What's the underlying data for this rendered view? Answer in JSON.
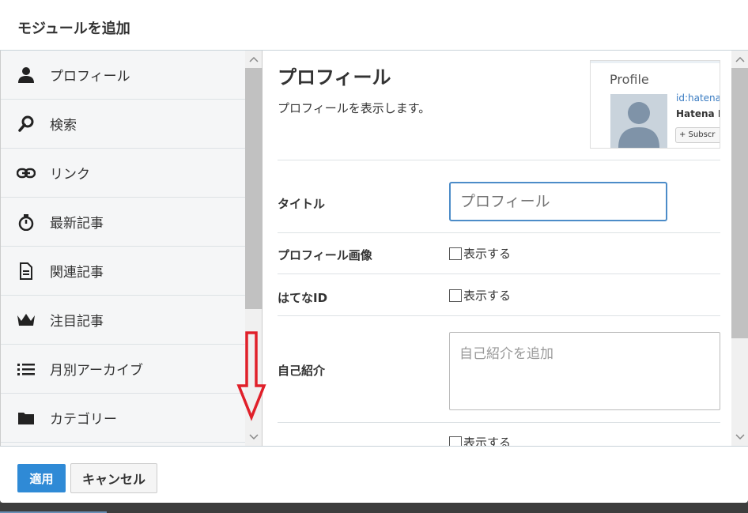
{
  "dialog": {
    "title": "モジュールを追加"
  },
  "sidebar": {
    "items": [
      {
        "label": "プロフィール",
        "icon": "person-icon"
      },
      {
        "label": "検索",
        "icon": "search-icon"
      },
      {
        "label": "リンク",
        "icon": "link-icon"
      },
      {
        "label": "最新記事",
        "icon": "stopwatch-icon"
      },
      {
        "label": "関連記事",
        "icon": "document-icon"
      },
      {
        "label": "注目記事",
        "icon": "crown-icon"
      },
      {
        "label": "月別アーカイブ",
        "icon": "list-icon"
      },
      {
        "label": "カテゴリー",
        "icon": "folder-icon"
      }
    ]
  },
  "module": {
    "title": "プロフィール",
    "description": "プロフィールを表示します。",
    "preview": {
      "heading": "Profile",
      "id_text": "id:hatena",
      "name_text": "Hatena B",
      "subscribe_text": "+ Subscr"
    }
  },
  "form": {
    "title_label": "タイトル",
    "title_placeholder": "プロフィール",
    "image_label": "プロフィール画像",
    "image_checkbox": "表示する",
    "hatena_id_label": "はてなID",
    "hatena_id_checkbox": "表示する",
    "intro_label": "自己紹介",
    "intro_placeholder": "自己紹介を追加",
    "next_checkbox": "表示する"
  },
  "footer": {
    "apply_label": "適用",
    "cancel_label": "キャンセル"
  },
  "colors": {
    "accent": "#2f8ad6",
    "annotation_arrow": "#e0202a"
  }
}
